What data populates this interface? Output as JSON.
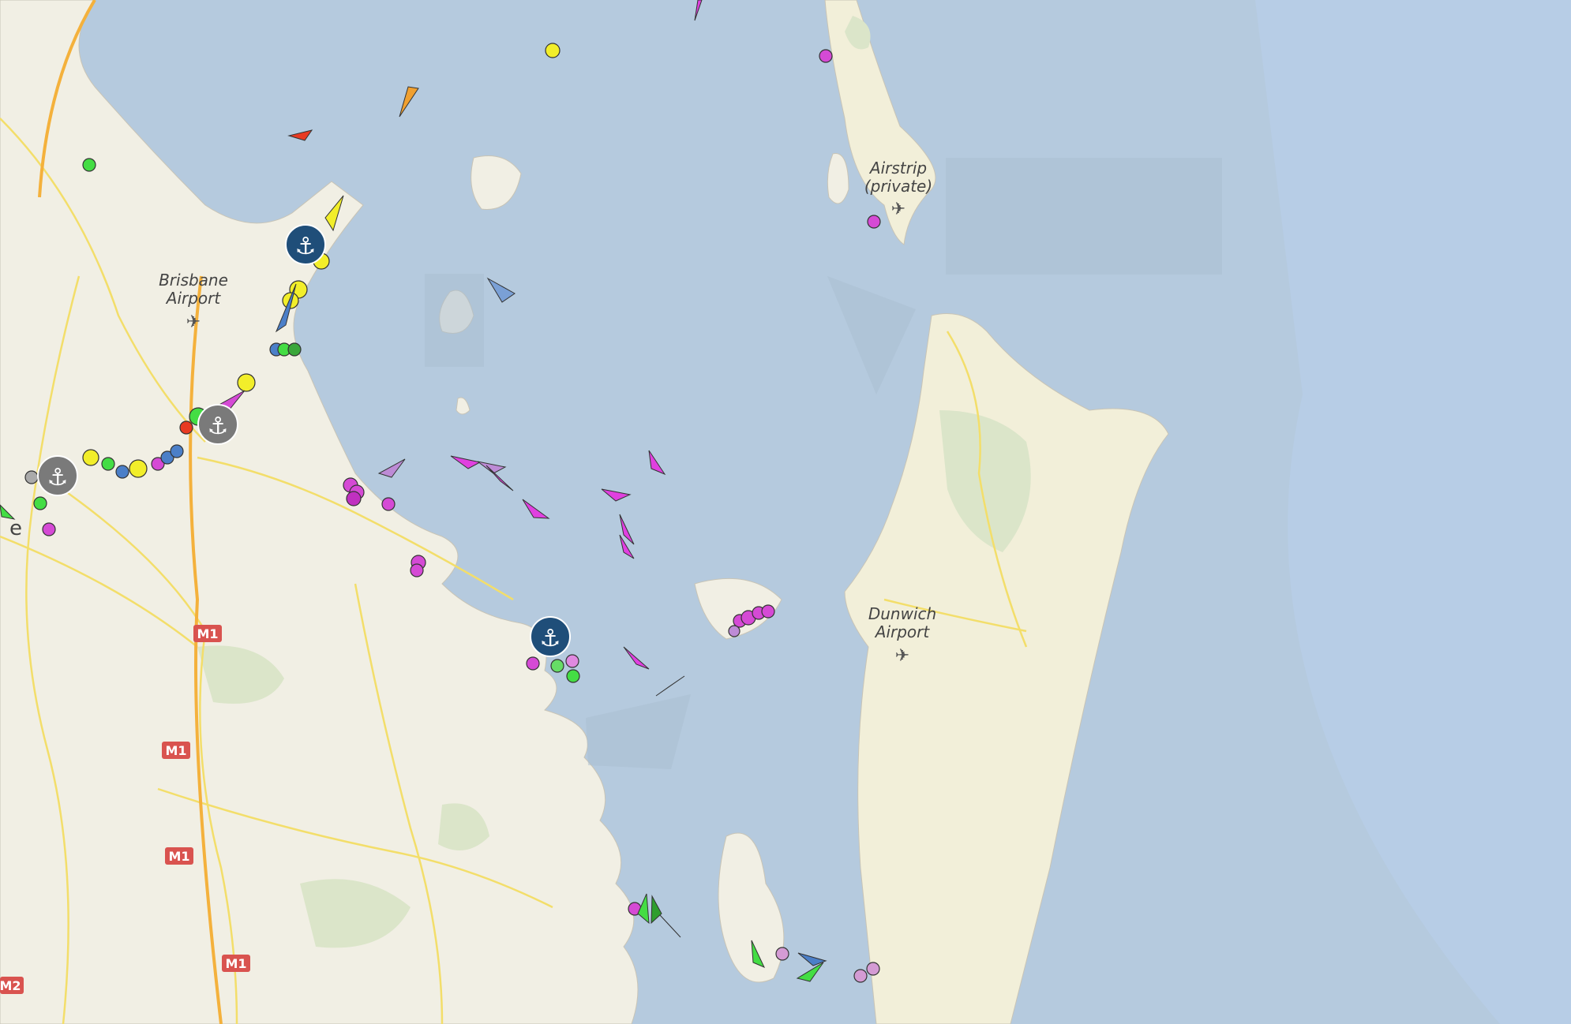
{
  "map": {
    "airports": [
      {
        "line1": "Brisbane",
        "line2": "Airport"
      },
      {
        "line1": "Airstrip",
        "line2": "(private)"
      },
      {
        "line1": "Dunwich",
        "line2": "Airport"
      }
    ],
    "roads": {
      "m1": "M1",
      "m2": "M2"
    },
    "partial_place_label": "e",
    "colors": {
      "water": "#b5cade",
      "land": "#f1efe4",
      "sand": "#f2efd9",
      "green": "#dbe5c9",
      "road": "#f3de6a",
      "anchor_blue": "#1f4e79",
      "anchor_grey": "#7a7a7a",
      "vessel_magenta": "#e040e0",
      "vessel_yellow": "#f2ee2a",
      "vessel_green": "#44dd44",
      "vessel_red": "#e83a22",
      "vessel_blue": "#4b7fc8",
      "vessel_orange": "#f0a030"
    },
    "icons": [
      "anchor-icon",
      "airport-plane-icon",
      "vessel-arrow-icon",
      "vessel-dot-icon"
    ]
  }
}
